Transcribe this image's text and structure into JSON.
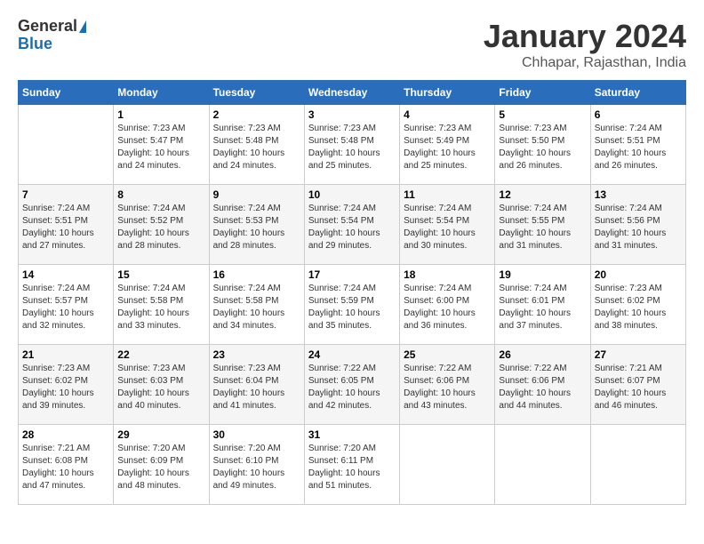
{
  "header": {
    "logo_line1": "General",
    "logo_line2": "Blue",
    "month": "January 2024",
    "location": "Chhapar, Rajasthan, India"
  },
  "days_of_week": [
    "Sunday",
    "Monday",
    "Tuesday",
    "Wednesday",
    "Thursday",
    "Friday",
    "Saturday"
  ],
  "weeks": [
    [
      {
        "day": "",
        "info": ""
      },
      {
        "day": "1",
        "info": "Sunrise: 7:23 AM\nSunset: 5:47 PM\nDaylight: 10 hours\nand 24 minutes."
      },
      {
        "day": "2",
        "info": "Sunrise: 7:23 AM\nSunset: 5:48 PM\nDaylight: 10 hours\nand 24 minutes."
      },
      {
        "day": "3",
        "info": "Sunrise: 7:23 AM\nSunset: 5:48 PM\nDaylight: 10 hours\nand 25 minutes."
      },
      {
        "day": "4",
        "info": "Sunrise: 7:23 AM\nSunset: 5:49 PM\nDaylight: 10 hours\nand 25 minutes."
      },
      {
        "day": "5",
        "info": "Sunrise: 7:23 AM\nSunset: 5:50 PM\nDaylight: 10 hours\nand 26 minutes."
      },
      {
        "day": "6",
        "info": "Sunrise: 7:24 AM\nSunset: 5:51 PM\nDaylight: 10 hours\nand 26 minutes."
      }
    ],
    [
      {
        "day": "7",
        "info": "Sunrise: 7:24 AM\nSunset: 5:51 PM\nDaylight: 10 hours\nand 27 minutes."
      },
      {
        "day": "8",
        "info": "Sunrise: 7:24 AM\nSunset: 5:52 PM\nDaylight: 10 hours\nand 28 minutes."
      },
      {
        "day": "9",
        "info": "Sunrise: 7:24 AM\nSunset: 5:53 PM\nDaylight: 10 hours\nand 28 minutes."
      },
      {
        "day": "10",
        "info": "Sunrise: 7:24 AM\nSunset: 5:54 PM\nDaylight: 10 hours\nand 29 minutes."
      },
      {
        "day": "11",
        "info": "Sunrise: 7:24 AM\nSunset: 5:54 PM\nDaylight: 10 hours\nand 30 minutes."
      },
      {
        "day": "12",
        "info": "Sunrise: 7:24 AM\nSunset: 5:55 PM\nDaylight: 10 hours\nand 31 minutes."
      },
      {
        "day": "13",
        "info": "Sunrise: 7:24 AM\nSunset: 5:56 PM\nDaylight: 10 hours\nand 31 minutes."
      }
    ],
    [
      {
        "day": "14",
        "info": "Sunrise: 7:24 AM\nSunset: 5:57 PM\nDaylight: 10 hours\nand 32 minutes."
      },
      {
        "day": "15",
        "info": "Sunrise: 7:24 AM\nSunset: 5:58 PM\nDaylight: 10 hours\nand 33 minutes."
      },
      {
        "day": "16",
        "info": "Sunrise: 7:24 AM\nSunset: 5:58 PM\nDaylight: 10 hours\nand 34 minutes."
      },
      {
        "day": "17",
        "info": "Sunrise: 7:24 AM\nSunset: 5:59 PM\nDaylight: 10 hours\nand 35 minutes."
      },
      {
        "day": "18",
        "info": "Sunrise: 7:24 AM\nSunset: 6:00 PM\nDaylight: 10 hours\nand 36 minutes."
      },
      {
        "day": "19",
        "info": "Sunrise: 7:24 AM\nSunset: 6:01 PM\nDaylight: 10 hours\nand 37 minutes."
      },
      {
        "day": "20",
        "info": "Sunrise: 7:23 AM\nSunset: 6:02 PM\nDaylight: 10 hours\nand 38 minutes."
      }
    ],
    [
      {
        "day": "21",
        "info": "Sunrise: 7:23 AM\nSunset: 6:02 PM\nDaylight: 10 hours\nand 39 minutes."
      },
      {
        "day": "22",
        "info": "Sunrise: 7:23 AM\nSunset: 6:03 PM\nDaylight: 10 hours\nand 40 minutes."
      },
      {
        "day": "23",
        "info": "Sunrise: 7:23 AM\nSunset: 6:04 PM\nDaylight: 10 hours\nand 41 minutes."
      },
      {
        "day": "24",
        "info": "Sunrise: 7:22 AM\nSunset: 6:05 PM\nDaylight: 10 hours\nand 42 minutes."
      },
      {
        "day": "25",
        "info": "Sunrise: 7:22 AM\nSunset: 6:06 PM\nDaylight: 10 hours\nand 43 minutes."
      },
      {
        "day": "26",
        "info": "Sunrise: 7:22 AM\nSunset: 6:06 PM\nDaylight: 10 hours\nand 44 minutes."
      },
      {
        "day": "27",
        "info": "Sunrise: 7:21 AM\nSunset: 6:07 PM\nDaylight: 10 hours\nand 46 minutes."
      }
    ],
    [
      {
        "day": "28",
        "info": "Sunrise: 7:21 AM\nSunset: 6:08 PM\nDaylight: 10 hours\nand 47 minutes."
      },
      {
        "day": "29",
        "info": "Sunrise: 7:20 AM\nSunset: 6:09 PM\nDaylight: 10 hours\nand 48 minutes."
      },
      {
        "day": "30",
        "info": "Sunrise: 7:20 AM\nSunset: 6:10 PM\nDaylight: 10 hours\nand 49 minutes."
      },
      {
        "day": "31",
        "info": "Sunrise: 7:20 AM\nSunset: 6:11 PM\nDaylight: 10 hours\nand 51 minutes."
      },
      {
        "day": "",
        "info": ""
      },
      {
        "day": "",
        "info": ""
      },
      {
        "day": "",
        "info": ""
      }
    ]
  ]
}
